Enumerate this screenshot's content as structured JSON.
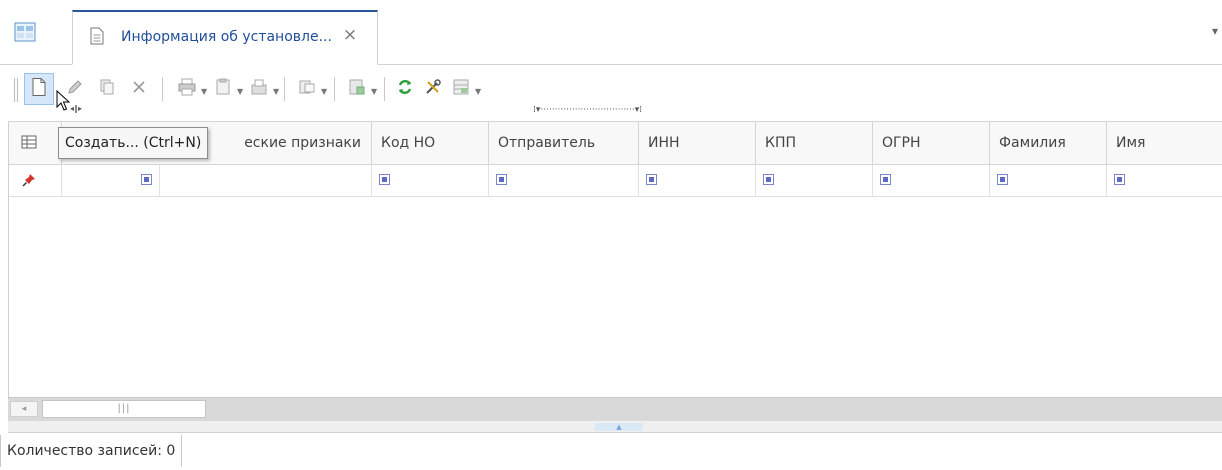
{
  "tab": {
    "title": "Информация об установле...",
    "close_glyph": "×",
    "home_icon": "table-view-icon",
    "doc_icon": "document-icon"
  },
  "toolbar": {
    "buttons": [
      {
        "name": "create-button",
        "icon": "new-document-icon"
      },
      {
        "name": "edit-button",
        "icon": "pencil-icon"
      },
      {
        "name": "copy-button",
        "icon": "copy-icon"
      },
      {
        "name": "delete-button",
        "icon": "close-icon"
      },
      {
        "name": "print-button",
        "icon": "printer-icon"
      },
      {
        "name": "reports-button",
        "icon": "report-icon"
      },
      {
        "name": "export-button",
        "icon": "export-icon"
      },
      {
        "name": "documents-button",
        "icon": "document-stack-icon"
      },
      {
        "name": "filter-button",
        "icon": "filter-icon"
      },
      {
        "name": "refresh-button",
        "icon": "refresh-icon"
      },
      {
        "name": "settings-button",
        "icon": "tools-icon"
      },
      {
        "name": "extra-button",
        "icon": "table-icon"
      }
    ]
  },
  "tooltip": {
    "text": "Создать... (Ctrl+N)"
  },
  "grid": {
    "columns": [
      {
        "label": ""
      },
      {
        "label": "еские признаки"
      },
      {
        "label": "Код НО"
      },
      {
        "label": "Отправитель"
      },
      {
        "label": "ИНН"
      },
      {
        "label": "КПП"
      },
      {
        "label": "ОГРН"
      },
      {
        "label": "Фамилия"
      },
      {
        "label": "Имя"
      }
    ],
    "rows": []
  },
  "status": {
    "record_count": "Количество записей: 0"
  },
  "colors": {
    "accent": "#2b579a",
    "hover": "#d5e7f8",
    "filter_icon": "#5c6bc0",
    "refresh": "#2e9e3a"
  }
}
